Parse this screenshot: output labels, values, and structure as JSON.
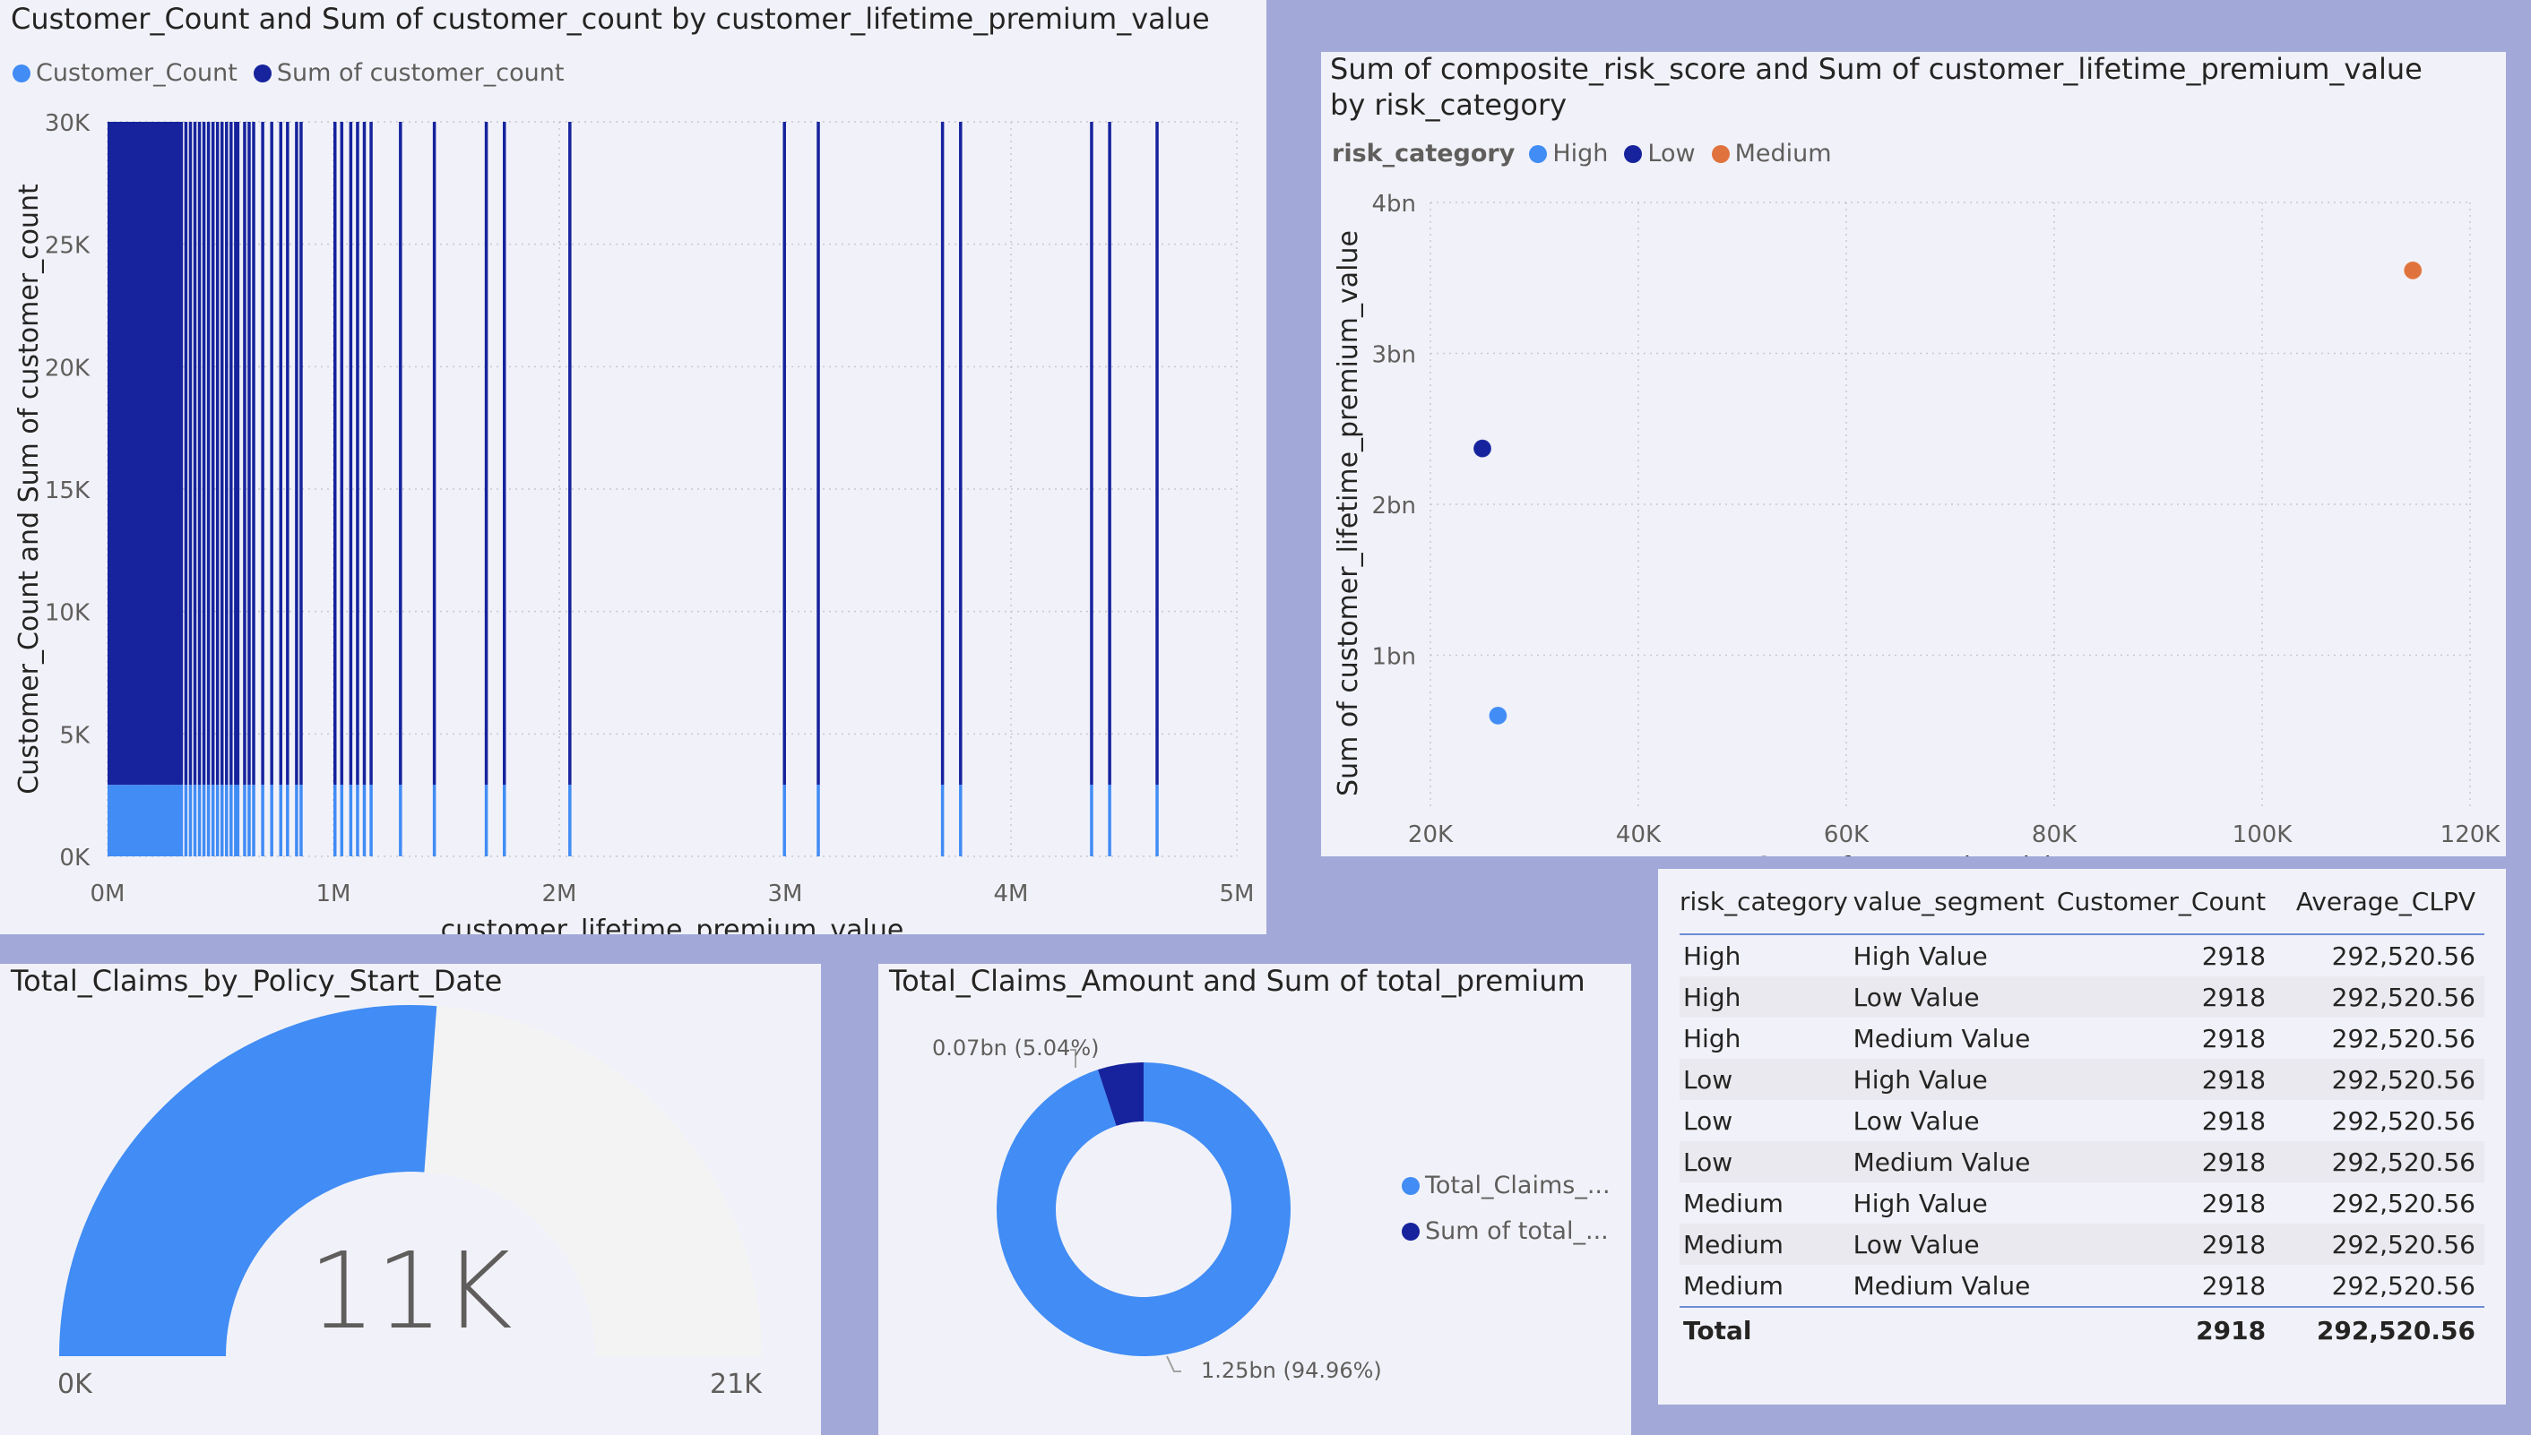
{
  "colors": {
    "light_blue": "#418cf5",
    "dark_blue": "#16239d",
    "orange": "#e0733d",
    "gauge_bg": "#f3f3f3"
  },
  "chart1": {
    "title": "Customer_Count and Sum of customer_count by customer_lifetime_premium_value",
    "legend": [
      "Customer_Count",
      "Sum of customer_count"
    ]
  },
  "chart2": {
    "title_line1": "Sum of composite_risk_score and Sum of customer_lifetime_premium_value",
    "title_line2": "by risk_category",
    "legend_label": "risk_category",
    "legend": [
      "High",
      "Low",
      "Medium"
    ]
  },
  "gauge": {
    "title": "Total_Claims_by_Policy_Start_Date",
    "value_label": "11K",
    "min_label": "0K",
    "max_label": "21K",
    "value": 11,
    "max": 21
  },
  "donut": {
    "title": "Total_Claims_Amount and Sum of total_premium",
    "legend": [
      "Total_Claims_...",
      "Sum of total_..."
    ],
    "label_small": "0.07bn (5.04%)",
    "label_big": "1.25bn (94.96%)"
  },
  "table": {
    "headers": [
      "risk_category",
      "value_segment",
      "Customer_Count",
      "Average_CLPV"
    ],
    "rows": [
      [
        "High",
        "High Value",
        "2918",
        "292,520.56"
      ],
      [
        "High",
        "Low Value",
        "2918",
        "292,520.56"
      ],
      [
        "High",
        "Medium Value",
        "2918",
        "292,520.56"
      ],
      [
        "Low",
        "High Value",
        "2918",
        "292,520.56"
      ],
      [
        "Low",
        "Low Value",
        "2918",
        "292,520.56"
      ],
      [
        "Low",
        "Medium Value",
        "2918",
        "292,520.56"
      ],
      [
        "Medium",
        "High Value",
        "2918",
        "292,520.56"
      ],
      [
        "Medium",
        "Low Value",
        "2918",
        "292,520.56"
      ],
      [
        "Medium",
        "Medium Value",
        "2918",
        "292,520.56"
      ]
    ],
    "total": [
      "Total",
      "",
      "2918",
      "292,520.56"
    ]
  },
  "chart_data": [
    {
      "type": "bar",
      "title": "Customer_Count and Sum of customer_count by customer_lifetime_premium_value",
      "xlabel": "customer_lifetime_premium_value",
      "ylabel": "Customer_Count and Sum of customer_count",
      "xlim": [
        0,
        5000000
      ],
      "ylim": [
        0,
        30000
      ],
      "x_ticks": [
        "0M",
        "1M",
        "2M",
        "3M",
        "4M",
        "5M"
      ],
      "y_ticks": [
        "0K",
        "5K",
        "10K",
        "15K",
        "20K",
        "25K",
        "30K"
      ],
      "legend_position": "top-left",
      "x": [
        0,
        50000,
        100000,
        150000,
        200000,
        250000,
        300000,
        320000,
        340000,
        360000,
        380000,
        400000,
        420000,
        440000,
        460000,
        480000,
        500000,
        520000,
        540000,
        560000,
        570000,
        600000,
        620000,
        640000,
        680000,
        720000,
        760000,
        790000,
        830000,
        850000,
        1000000,
        1030000,
        1070000,
        1100000,
        1130000,
        1160000,
        1290000,
        1440000,
        1670000,
        1750000,
        2040000,
        2990000,
        3140000,
        3690000,
        3770000,
        4350000,
        4430000,
        4640000
      ],
      "series": [
        {
          "name": "Customer_Count",
          "values_const": 2918
        },
        {
          "name": "Sum of customer_count",
          "values_const": 30000
        }
      ]
    },
    {
      "type": "scatter",
      "title": "Sum of composite_risk_score and Sum of customer_lifetime_premium_value by risk_category",
      "xlabel": "Sum of composite_risk_score",
      "ylabel": "Sum of customer_lifetime_premium_value",
      "xlim": [
        20000,
        120000
      ],
      "ylim": [
        0,
        4000000000
      ],
      "x_ticks": [
        "20K",
        "40K",
        "60K",
        "80K",
        "100K",
        "120K"
      ],
      "y_ticks": [
        "1bn",
        "2bn",
        "3bn",
        "4bn"
      ],
      "legend_position": "top-left",
      "series": [
        {
          "name": "High",
          "x": 26500,
          "y": 600000000
        },
        {
          "name": "Low",
          "x": 25000,
          "y": 2370000000
        },
        {
          "name": "Medium",
          "x": 114500,
          "y": 3550000000
        }
      ]
    },
    {
      "type": "pie",
      "title": "Total_Claims_Amount and Sum of total_premium",
      "slices": [
        {
          "name": "Total_Claims_...",
          "value": 1.25,
          "percent": 94.96
        },
        {
          "name": "Sum of total_...",
          "value": 0.07,
          "percent": 5.04
        }
      ]
    }
  ]
}
